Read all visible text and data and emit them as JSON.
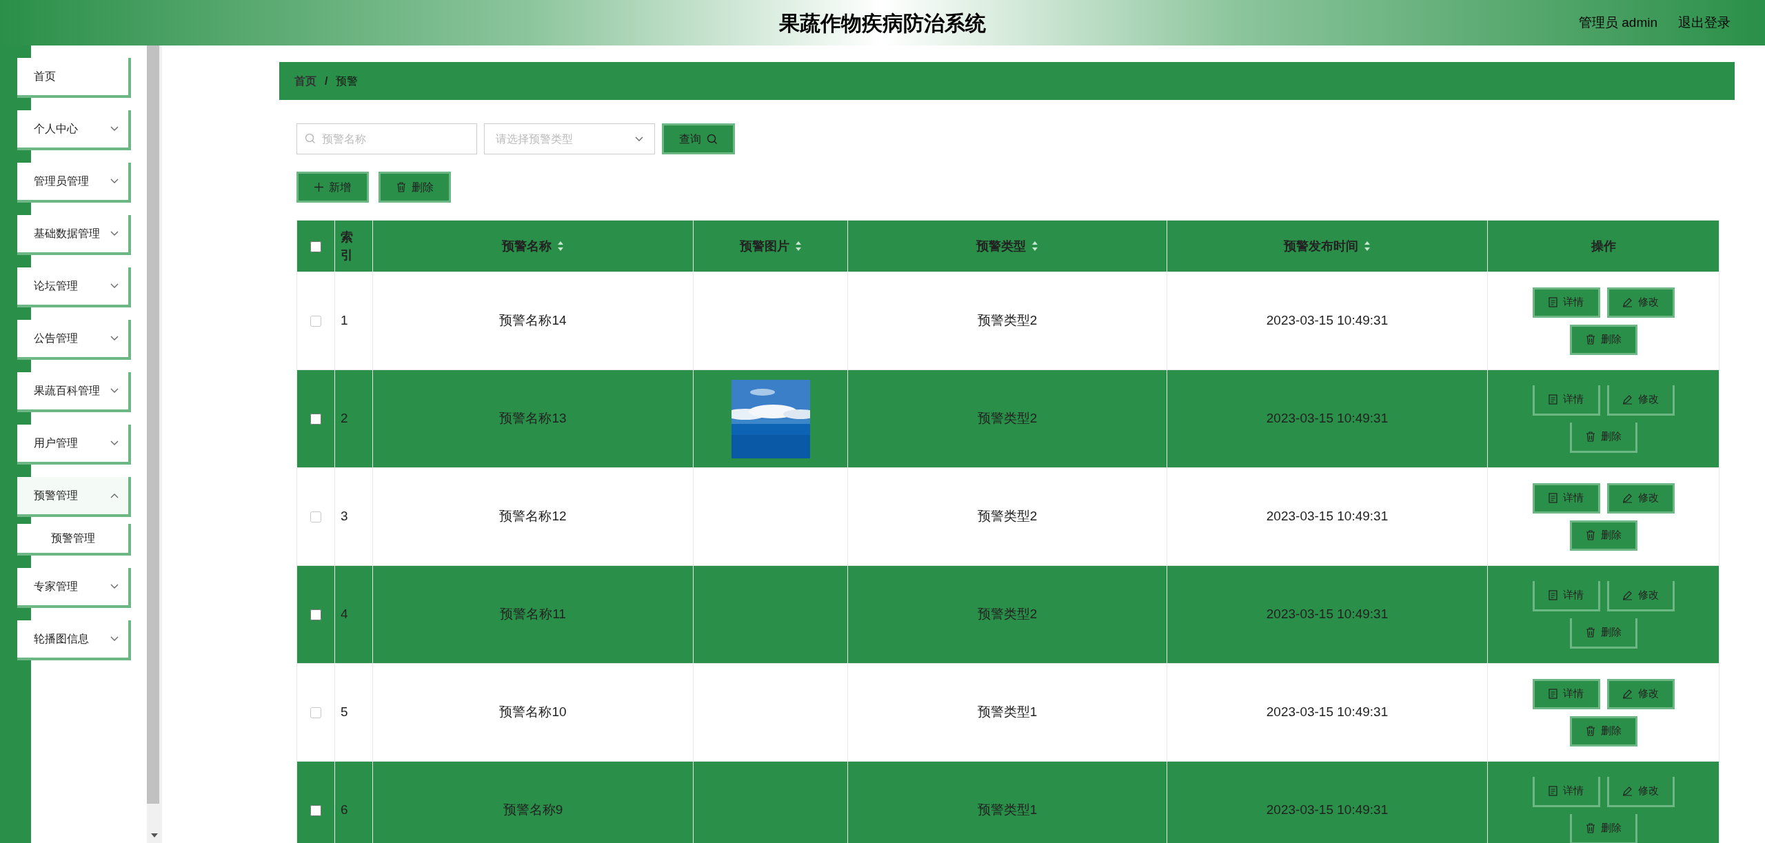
{
  "header": {
    "title": "果蔬作物疾病防治系统",
    "user": "管理员 admin",
    "logout": "退出登录"
  },
  "sidebar": {
    "items": [
      {
        "label": "首页"
      },
      {
        "label": "个人中心",
        "expanded": false
      },
      {
        "label": "管理员管理",
        "expanded": false
      },
      {
        "label": "基础数据管理",
        "expanded": false
      },
      {
        "label": "论坛管理",
        "expanded": false
      },
      {
        "label": "公告管理",
        "expanded": false
      },
      {
        "label": "果蔬百科管理",
        "expanded": false
      },
      {
        "label": "用户管理",
        "expanded": false
      },
      {
        "label": "预警管理",
        "expanded": true,
        "children": [
          {
            "label": "预警管理"
          }
        ]
      },
      {
        "label": "专家管理",
        "expanded": false
      },
      {
        "label": "轮播图信息",
        "expanded": false
      }
    ]
  },
  "breadcrumb": {
    "items": [
      "首页",
      "预警"
    ],
    "separator": "/"
  },
  "search": {
    "name_placeholder": "预警名称",
    "type_placeholder": "请选择预警类型",
    "query_button": "查询"
  },
  "actions": {
    "add": "新增",
    "delete": "删除"
  },
  "table": {
    "select_all_checked": false,
    "columns": [
      {
        "label": "索引",
        "sortable": false
      },
      {
        "label": "预警名称",
        "sortable": true
      },
      {
        "label": "预警图片",
        "sortable": true
      },
      {
        "label": "预警类型",
        "sortable": true
      },
      {
        "label": "预警发布时间",
        "sortable": true
      },
      {
        "label": "操作",
        "sortable": false
      }
    ],
    "rows": [
      {
        "checked": false,
        "index": "1",
        "name": "预警名称14",
        "image": null,
        "type": "预警类型2",
        "time": "2023-03-15 10:49:31",
        "buttons": {
          "detail": "详情",
          "edit": "修改",
          "delete": "删除"
        }
      },
      {
        "checked": false,
        "index": "2",
        "name": "预警名称13",
        "type": "预警类型2",
        "time": "2023-03-15 10:49:31",
        "buttons": {
          "detail": "详情",
          "edit": "修改",
          "delete": "删除"
        }
      },
      {
        "checked": false,
        "index": "3",
        "name": "预警名称12",
        "image": null,
        "type": "预警类型2",
        "time": "2023-03-15 10:49:31",
        "buttons": {
          "detail": "详情",
          "edit": "修改",
          "delete": "删除"
        }
      },
      {
        "checked": false,
        "index": "4",
        "name": "预警名称11",
        "image": null,
        "type": "预警类型2",
        "time": "2023-03-15 10:49:31",
        "buttons": {
          "detail": "详情",
          "edit": "修改",
          "delete": "删除"
        }
      },
      {
        "checked": false,
        "index": "5",
        "name": "预警名称10",
        "image": null,
        "type": "预警类型1",
        "time": "2023-03-15 10:49:31",
        "buttons": {
          "detail": "详情",
          "edit": "修改",
          "delete": "删除"
        }
      },
      {
        "checked": false,
        "index": "6",
        "name": "预警名称9",
        "image": null,
        "type": "预警类型1",
        "time": "2023-03-15 10:49:31",
        "buttons": {
          "detail": "详情",
          "edit": "修改",
          "delete": "删除"
        }
      }
    ]
  }
}
